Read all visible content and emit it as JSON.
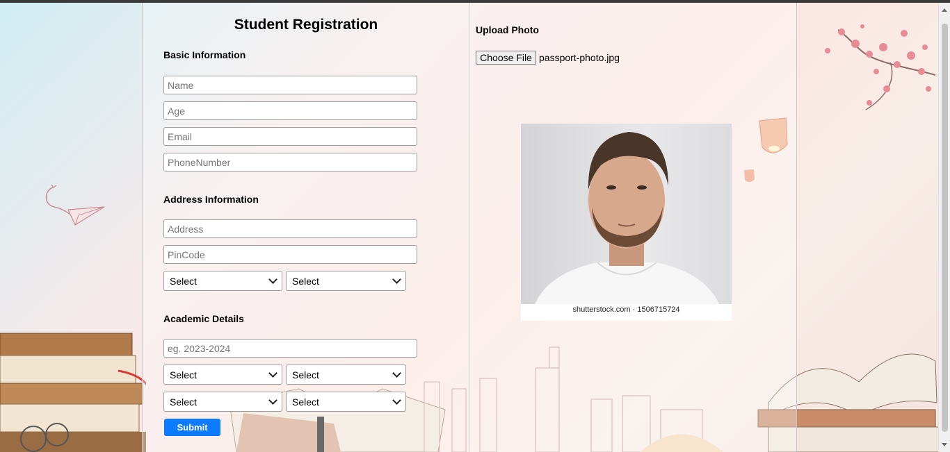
{
  "form": {
    "title": "Student Registration",
    "basic": {
      "heading": "Basic Information",
      "name_placeholder": "Name",
      "age_placeholder": "Age",
      "email_placeholder": "Email",
      "phone_placeholder": "PhoneNumber"
    },
    "address": {
      "heading": "Address Information",
      "address_placeholder": "Address",
      "pincode_placeholder": "PinCode",
      "select1": "Select",
      "select2": "Select"
    },
    "academic": {
      "heading": "Academic Details",
      "year_placeholder": "eg. 2023-2024",
      "select1": "Select",
      "select2": "Select",
      "select3": "Select",
      "select4": "Select"
    },
    "submit_label": "Submit"
  },
  "upload": {
    "heading": "Upload Photo",
    "button_label": "Choose File",
    "file_name": "passport-photo.jpg",
    "watermark": "shutterstock.com · 1506715724"
  },
  "colors": {
    "submit": "#0d7bff"
  }
}
